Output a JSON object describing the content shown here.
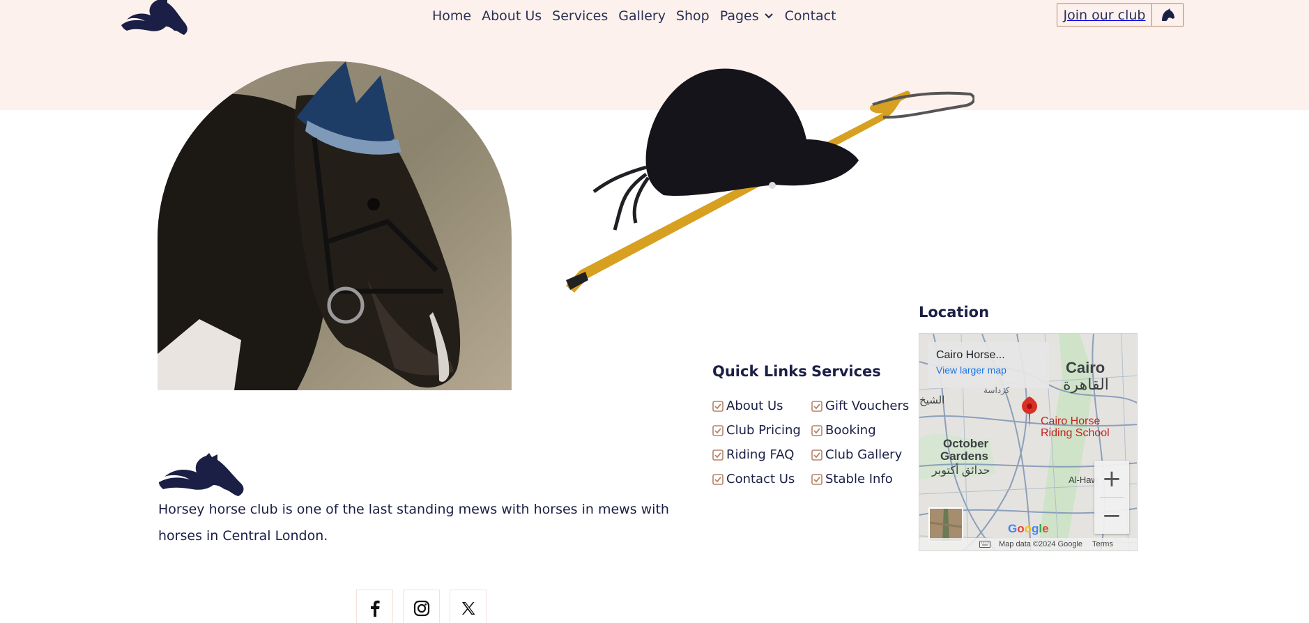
{
  "nav": {
    "items": [
      {
        "label": "Home"
      },
      {
        "label": "About Us"
      },
      {
        "label": "Services"
      },
      {
        "label": "Gallery"
      },
      {
        "label": "Shop"
      },
      {
        "label": "Pages"
      },
      {
        "label": "Contact"
      }
    ],
    "join_label": "Join our club"
  },
  "about": {
    "text": "Horsey horse club is one of the last standing mews with horses in mews with horses in Central London."
  },
  "quick_links": {
    "title": "Quick Links",
    "items": [
      "About Us",
      "Club Pricing",
      "Riding FAQ",
      "Contact Us"
    ]
  },
  "services": {
    "title": "Services",
    "items": [
      "Gift Vouchers",
      "Booking",
      "Club Gallery",
      "Stable Info"
    ]
  },
  "location": {
    "title": "Location",
    "map": {
      "card_title": "Cairo Horse...",
      "card_link": "View larger map",
      "pin_label_line1": "Cairo Horse",
      "pin_label_line2": "Riding School",
      "city": "Cairo",
      "city_ar": "القاهرة",
      "place1": "October",
      "place2": "Gardens",
      "place_ar": "حدائق أكتوبر",
      "place_left_ar": "الشيخ",
      "place_small": "كرداسة",
      "place_right": "Al-Haw",
      "zoom_in": "+",
      "zoom_out": "−",
      "google": "Google",
      "attribution": "Map data ©2024 Google",
      "terms": "Terms"
    }
  },
  "colors": {
    "top_band": "#fcf1ec",
    "navy": "#1b1f45",
    "accent": "#b48468"
  }
}
